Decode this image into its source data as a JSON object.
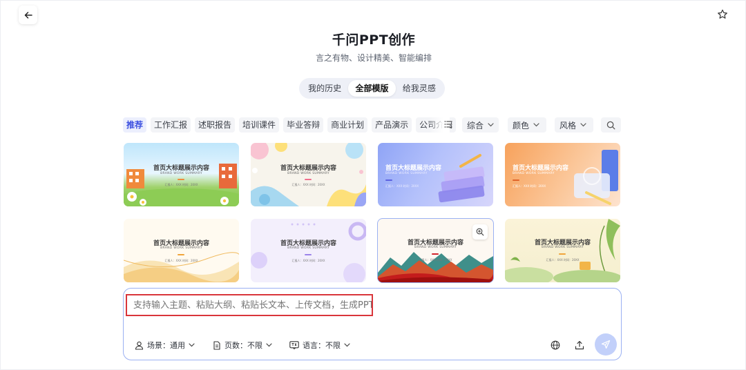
{
  "header": {
    "title": "千问PPT创作",
    "subtitle": "言之有物、设计精美、智能编排"
  },
  "tabs": [
    {
      "label": "我的历史",
      "active": false
    },
    {
      "label": "全部模版",
      "active": true
    },
    {
      "label": "给我灵感",
      "active": false
    }
  ],
  "categories": [
    {
      "label": "推荐",
      "active": true
    },
    {
      "label": "工作汇报",
      "active": false
    },
    {
      "label": "述职报告",
      "active": false
    },
    {
      "label": "培训课件",
      "active": false
    },
    {
      "label": "毕业答辩",
      "active": false
    },
    {
      "label": "商业计划",
      "active": false
    },
    {
      "label": "产品演示",
      "active": false
    },
    {
      "label": "公司介绍",
      "active": false
    }
  ],
  "filters": {
    "sort": "综合",
    "color": "颜色",
    "style": "风格"
  },
  "templates": [
    {
      "title": "首页大标题展示内容",
      "subtitle": "BRAND WORK SUMMARY",
      "meta": "汇报人：XXX  时间：20XX",
      "theme": "campus"
    },
    {
      "title": "首页大标题展示内容",
      "subtitle": "BRAND WORK SUMMARY",
      "meta": "汇报人：XXX  时间：20XX",
      "theme": "cartoon"
    },
    {
      "title": "首页大标题展示内容",
      "subtitle": "BRAND WORK SUMMARY",
      "meta": "汇报人：XXX  时间：20XX",
      "theme": "blue-purple"
    },
    {
      "title": "首页大标题展示内容",
      "subtitle": "BRAND WORK SUMMARY",
      "meta": "汇报人：XXX  时间：20XX",
      "theme": "orange"
    },
    {
      "title": "首页大标题展示内容",
      "subtitle": "BRAND WORK SUMMARY",
      "meta": "汇报人：XXX  时间：20XX",
      "theme": "gold-wave"
    },
    {
      "title": "首页大标题展示内容",
      "subtitle": "BRAND WORK SUMMARY",
      "meta": "汇报人：XXX  时间：20XX",
      "theme": "lavender"
    },
    {
      "title": "首页大标题展示内容",
      "subtitle": "BRAND WORK SUMMARY",
      "meta": "汇报人：XXX  时间：20XX",
      "theme": "red-mountain"
    },
    {
      "title": "首页大标题展示内容",
      "subtitle": "BRAND WORK SUMMARY",
      "meta": "汇报人：XXX  时间：20XX",
      "theme": "green-nature"
    }
  ],
  "composer": {
    "placeholder": "支持输入主题、粘贴大纲、粘贴长文本、上传文档，生成PPT",
    "scene_label": "场景：通用",
    "pages_label": "页数：不限",
    "language_label": "语言：不限"
  },
  "icons": {
    "back": "arrow-left-icon",
    "favorite": "star-icon",
    "list": "list-icon",
    "search": "search-icon",
    "zoom": "zoom-in-icon",
    "scene": "person-icon",
    "pages": "document-icon",
    "language": "translate-icon",
    "web": "globe-icon",
    "upload": "upload-icon",
    "send": "send-icon"
  },
  "colors": {
    "accent": "#3b4fe0",
    "input_border": "#9ab0f2",
    "highlight_box": "#d9353a",
    "send_button": "#c2d0fa"
  }
}
